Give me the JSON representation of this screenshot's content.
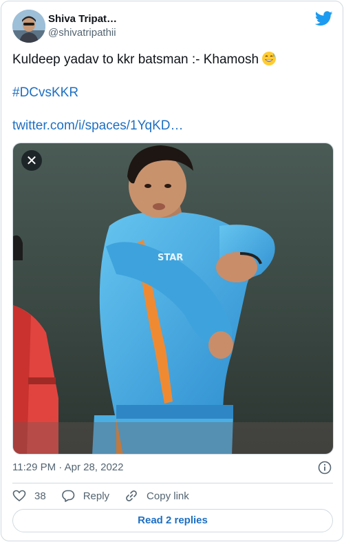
{
  "author": {
    "name": "Shiva Tripat…",
    "handle": "@shivatripathii",
    "avatar_icon": "user-avatar"
  },
  "brand": {
    "icon": "twitter-bird-icon",
    "color": "#1d9bf0"
  },
  "tweet": {
    "line1": "Kuldeep yadav to kkr batsman :- Khamosh",
    "emoji": "grinning-face-with-sweat-emoji",
    "hashtag": "#DCvsKKR",
    "link": "twitter.com/i/spaces/1YqKD…"
  },
  "media": {
    "description_icon": "photo-of-cricket-bowler",
    "close_icon": "close-icon",
    "close_glyph": "✕"
  },
  "meta": {
    "timestamp": "11:29 PM · Apr 28, 2022",
    "info_icon": "info-icon"
  },
  "actions": {
    "likes_count": "38",
    "reply_label": "Reply",
    "copy_link_label": "Copy link"
  },
  "read_replies_label": "Read 2 replies",
  "colors": {
    "link": "#1d6fc2",
    "text": "#0f1419",
    "muted": "#536471",
    "border": "#cfd9de"
  }
}
